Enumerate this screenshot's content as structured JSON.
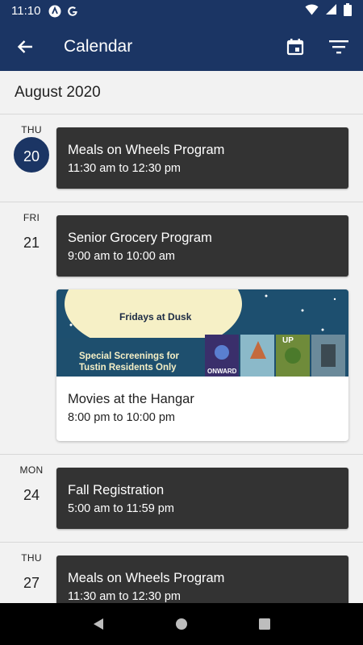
{
  "status": {
    "time": "11:10"
  },
  "header": {
    "title": "Calendar"
  },
  "month": "August 2020",
  "days": [
    {
      "dow": "THU",
      "num": "20",
      "events": [
        {
          "title": "Meals on Wheels Program",
          "hours": "11:30 am to 12:30 pm"
        }
      ]
    },
    {
      "dow": "FRI",
      "num": "21",
      "events": [
        {
          "title": "Senior Grocery Program",
          "hours": "9:00 am to 10:00 am"
        }
      ],
      "card": {
        "title": "Movies at the Hangar",
        "hours": "8:00 pm to 10:00 pm",
        "banner": {
          "heading": "Fridays at Dusk",
          "line1": "Special Screenings for",
          "line2": "Tustin Residents Only",
          "poster1": "ONWARD",
          "poster3": "UP"
        }
      }
    },
    {
      "dow": "MON",
      "num": "24",
      "events": [
        {
          "title": "Fall Registration",
          "hours": "5:00 am to 11:59 pm"
        }
      ]
    },
    {
      "dow": "THU",
      "num": "27",
      "events": [
        {
          "title": "Meals on Wheels Program",
          "hours": "11:30 am to 12:30 pm"
        }
      ]
    }
  ],
  "colors": {
    "primary": "#1b3564",
    "event_bg": "#333333",
    "background": "#f2f2f2"
  },
  "icons": {
    "back": "arrow-left-icon",
    "calendar": "calendar-icon",
    "filter": "filter-icon"
  }
}
